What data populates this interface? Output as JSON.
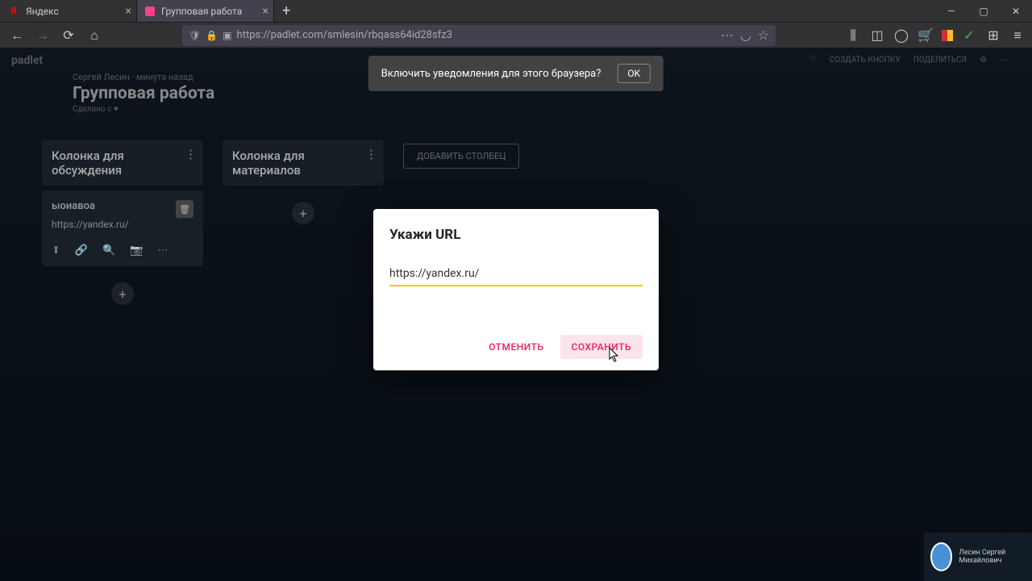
{
  "browser": {
    "tabs": [
      {
        "title": "Яндекс",
        "active": false
      },
      {
        "title": "Групповая работа",
        "active": true
      }
    ],
    "url": "https://padlet.com/smlesin/rbqass64id28sfz3"
  },
  "notification": {
    "text": "Включить уведомления для этого браузера?",
    "ok": "OK"
  },
  "padlet": {
    "logo": "padlet",
    "author": "Сергей Лесин",
    "timeago": "минута назад",
    "title": "Групповая работа",
    "made": "Сделано с ♥",
    "actions": {
      "create": "СОЗДАТЬ КНОПКУ",
      "share": "ПОДЕЛИТЬСЯ"
    }
  },
  "columns": [
    {
      "title": "Колонка для обсуждения",
      "cards": [
        {
          "title": "ыоиавоа",
          "url": "https://yandex.ru/"
        }
      ]
    },
    {
      "title": "Колонка для материалов",
      "cards": []
    }
  ],
  "addColumn": "ДОБАВИТЬ СТОЛБЕЦ",
  "modal": {
    "title": "Укажи URL",
    "value": "https://yandex.ru/",
    "cancel": "ОТМЕНИТЬ",
    "save": "СОХРАНИТЬ"
  },
  "user": {
    "name": "Лесин Сергей Михайлович"
  }
}
